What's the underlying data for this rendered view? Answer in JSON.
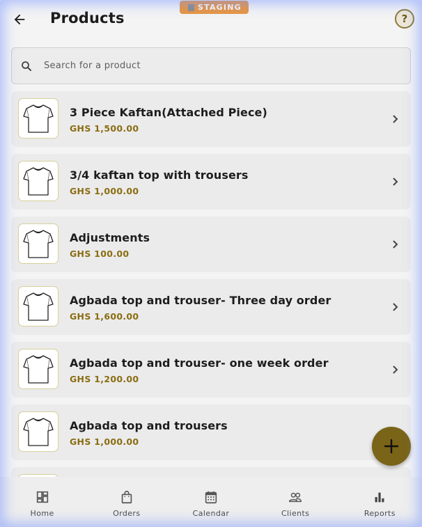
{
  "header": {
    "title": "Products",
    "staging_label": "STAGING",
    "help_label": "?"
  },
  "search": {
    "placeholder": "Search for a product"
  },
  "products": [
    {
      "name": "3 Piece Kaftan(Attached Piece)",
      "price": "GHS 1,500.00"
    },
    {
      "name": "3/4 kaftan top with trousers",
      "price": "GHS 1,000.00"
    },
    {
      "name": "Adjustments",
      "price": "GHS 100.00"
    },
    {
      "name": "Agbada top and trouser- Three day order",
      "price": "GHS 1,600.00"
    },
    {
      "name": "Agbada top and trouser- one week order",
      "price": "GHS 1,200.00"
    },
    {
      "name": "Agbada top and trousers",
      "price": "GHS 1,000.00"
    },
    {
      "name": "",
      "price": ""
    }
  ],
  "bottom_nav": {
    "items": [
      {
        "label": "Home",
        "icon": "dashboard-icon"
      },
      {
        "label": "Orders",
        "icon": "shopping-bag-icon"
      },
      {
        "label": "Calendar",
        "icon": "calendar-icon"
      },
      {
        "label": "Clients",
        "icon": "people-icon"
      },
      {
        "label": "Reports",
        "icon": "bar-chart-icon"
      }
    ]
  },
  "colors": {
    "accent": "#7a6418",
    "price": "#8a6d12",
    "staging": "#e8953f"
  }
}
